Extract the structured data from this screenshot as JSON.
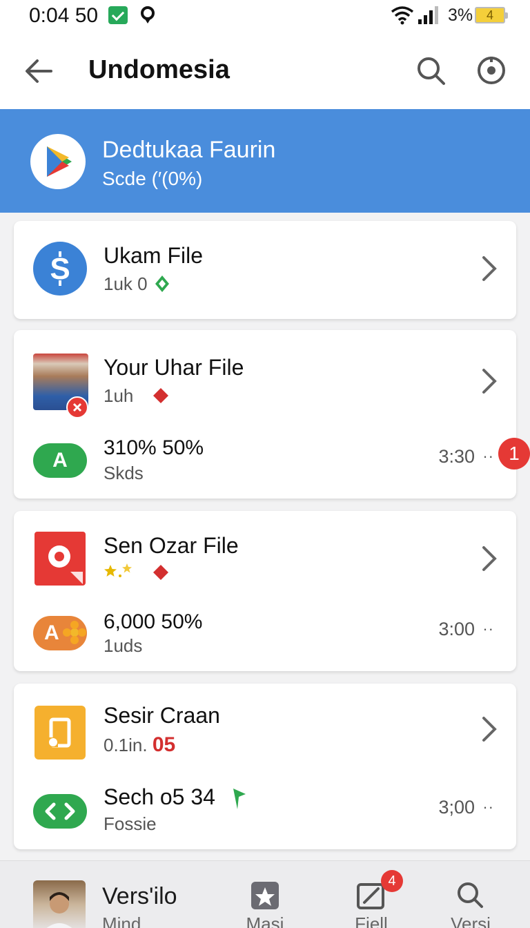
{
  "status_bar": {
    "time": "0:04 50",
    "battery_percent": "3%",
    "battery_label": "4"
  },
  "app_bar": {
    "title": "Undomesia"
  },
  "banner": {
    "title": "Dedtukaa Faurin",
    "subtitle": "Scde (′(0%)"
  },
  "cards": [
    {
      "rows": [
        {
          "title": "Ukam File",
          "subtitle": "1uk 0"
        }
      ]
    },
    {
      "rows": [
        {
          "title": "Your Uhar File",
          "subtitle": "1uh"
        },
        {
          "title": "310% 50%",
          "subtitle": "Skds",
          "time": "3:30",
          "more": "··",
          "badge": "1",
          "pill_label": "A"
        }
      ]
    },
    {
      "rows": [
        {
          "title": "Sen Ozar File",
          "subtitle": ""
        },
        {
          "title": "6,000 50%",
          "subtitle": "1uds",
          "time": "3:00",
          "more": "··",
          "pill_label": "A"
        }
      ]
    },
    {
      "rows": [
        {
          "title": "Sesir Craan",
          "subtitle": "0.1in.",
          "subtitle_accent": "05"
        },
        {
          "title": "Sech o5 34",
          "subtitle": "Fossie",
          "time": "3;00",
          "more": "··"
        }
      ]
    }
  ],
  "bottom_nav": {
    "profile_title": "Vers'ilo",
    "profile_sub": "Mind",
    "items": [
      {
        "label": "Masi",
        "icon": "star-icon"
      },
      {
        "label": "Fiell",
        "icon": "edit-icon",
        "badge": "4"
      },
      {
        "label": "Versi",
        "icon": "search-icon"
      }
    ]
  },
  "colors": {
    "banner": "#4a8ddc",
    "badge_red": "#e53935",
    "green": "#2fa84f",
    "orange": "#e8853a",
    "accent_red": "#d32f2f"
  }
}
